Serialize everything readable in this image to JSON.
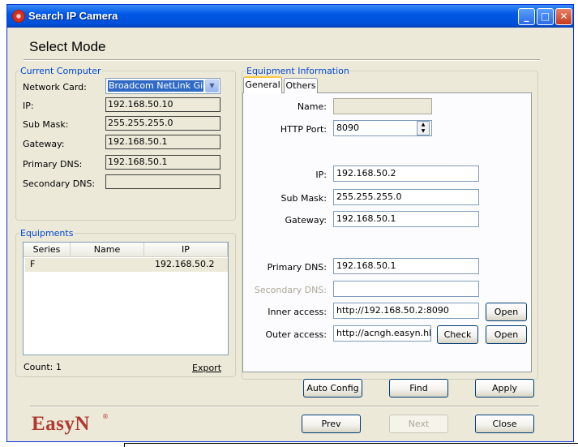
{
  "window": {
    "title": "Search IP Camera",
    "header_title": "Select Mode"
  },
  "current_computer": {
    "legend": "Current Computer",
    "network_card_label": "Network Card:",
    "network_card_value": "Broadcom NetLink Gigabit",
    "ip_label": "IP:",
    "ip_value": "192.168.50.10",
    "submask_label": "Sub Mask:",
    "submask_value": "255.255.255.0",
    "gateway_label": "Gateway:",
    "gateway_value": "192.168.50.1",
    "primary_dns_label": "Primary DNS:",
    "primary_dns_value": "192.168.50.1",
    "secondary_dns_label": "Secondary DNS:",
    "secondary_dns_value": ""
  },
  "equipments": {
    "legend": "Equipments",
    "columns": [
      "Series",
      "Name",
      "IP"
    ],
    "rows": [
      {
        "series": "F",
        "name": "",
        "ip": "192.168.50.2"
      }
    ],
    "count_label": "Count: 1",
    "export_label": "Export"
  },
  "equipment_info": {
    "legend": "Equipment Information",
    "tabs": [
      "General",
      "Others"
    ],
    "name_label": "Name:",
    "name_value": "",
    "http_port_label": "HTTP Port:",
    "http_port_value": "8090",
    "ip_label": "IP:",
    "ip_value": "192.168.50.2",
    "submask_label": "Sub Mask:",
    "submask_value": "255.255.255.0",
    "gateway_label": "Gateway:",
    "gateway_value": "192.168.50.1",
    "primary_dns_label": "Primary DNS:",
    "primary_dns_value": "192.168.50.1",
    "secondary_dns_label": "Secondary DNS:",
    "secondary_dns_value": "",
    "inner_access_label": "Inner access:",
    "inner_access_value": "http://192.168.50.2:8090",
    "outer_access_label": "Outer access:",
    "outer_access_value": "http://acngh.easyn.hk",
    "open_label": "Open",
    "check_label": "Check"
  },
  "actions": {
    "auto_config": "Auto Config",
    "find": "Find",
    "apply": "Apply",
    "prev": "Prev",
    "next": "Next",
    "close": "Close"
  },
  "brand": {
    "logo_text": "EasyN",
    "logo_mark": "®",
    "color": "#b03a32"
  },
  "colors": {
    "titlebar": "#0058e6",
    "legend_text": "#0046d5",
    "selection": "#316ac5",
    "dialog_bg": "#ece9d8"
  }
}
